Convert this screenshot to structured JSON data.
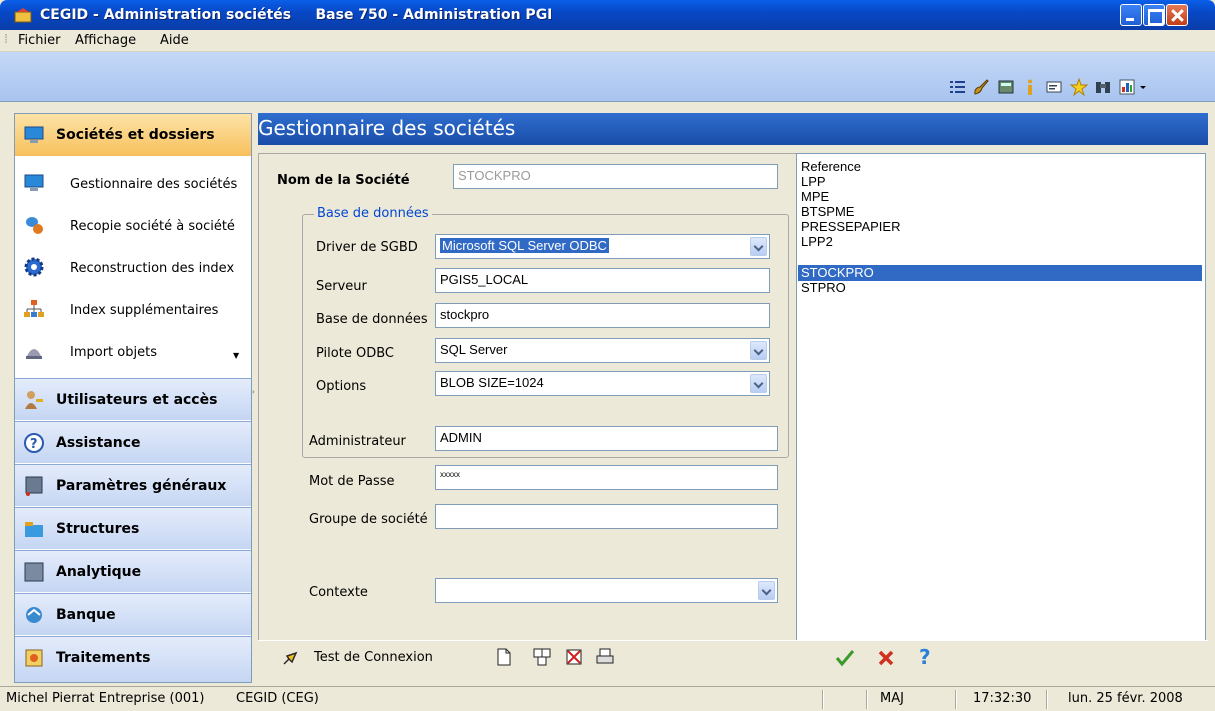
{
  "window": {
    "app_title": "CEGID - Administration sociétés     Base 750 - Administration PGI"
  },
  "menu": {
    "fichier": "Fichier",
    "affichage": "Affichage",
    "aide": "Aide"
  },
  "toolbar_icons": [
    "list-icon",
    "brush-icon",
    "calculator-icon",
    "info-icon",
    "window-icon",
    "star-icon",
    "binoculars-icon",
    "chart-icon"
  ],
  "sidebar": {
    "active_section": "Sociétés et dossiers",
    "items": [
      {
        "label": "Gestionnaire des sociétés",
        "icon": "monitor-icon"
      },
      {
        "label": "Recopie société à société",
        "icon": "copy-database-icon"
      },
      {
        "label": "Reconstruction des index",
        "icon": "gear-icon"
      },
      {
        "label": "Index supplémentaires",
        "icon": "hierarchy-icon"
      },
      {
        "label": "Import objets",
        "icon": "import-icon"
      }
    ],
    "sections": [
      {
        "label": "Utilisateurs et accès",
        "icon": "users-key-icon"
      },
      {
        "label": "Assistance",
        "icon": "help-circle-icon"
      },
      {
        "label": "Paramètres généraux",
        "icon": "settings-icon"
      },
      {
        "label": "Structures",
        "icon": "folder-icon"
      },
      {
        "label": "Analytique",
        "icon": "analytics-icon"
      },
      {
        "label": "Banque",
        "icon": "bank-icon"
      },
      {
        "label": "Traitements",
        "icon": "process-icon"
      }
    ]
  },
  "main": {
    "header": "Gestionnaire des sociétés",
    "form": {
      "nom_label": "Nom de la Société",
      "nom_value": "STOCKPRO",
      "group_title": "Base de données",
      "driver_label": "Driver de SGBD",
      "driver_value": "Microsoft SQL Server ODBC",
      "serveur_label": "Serveur",
      "serveur_value": "PGIS5_LOCAL",
      "base_label": "Base de données",
      "base_value": "stockpro",
      "pilote_label": "Pilote ODBC",
      "pilote_value": "SQL Server",
      "options_label": "Options",
      "options_value": "BLOB SIZE=1024",
      "admin_label": "Administrateur",
      "admin_value": "ADMIN",
      "pass_label": "Mot de Passe",
      "pass_value": "xxxxx",
      "groupe_label": "Groupe de société",
      "groupe_value": "",
      "contexte_label": "Contexte",
      "contexte_value": ""
    },
    "list": [
      "Reference",
      "LPP",
      "MPE",
      "BTSPME",
      "PRESSEPAPIER",
      "LPP2",
      "STOCKPRO",
      "STPRO"
    ],
    "selected_list_item": "STOCKPRO",
    "bottom": {
      "test_label": "Test de Connexion"
    }
  },
  "status": {
    "user": "Michel Pierrat Entreprise (001)",
    "base": "CEGID (CEG)",
    "caps": "MAJ",
    "time": "17:32:30",
    "date": "lun. 25 févr. 2008"
  },
  "colors": {
    "title_blue": "#0A5FE8",
    "header_blue": "#2f6ecf",
    "selection": "#316AC5",
    "active_section": "#f7c05c",
    "check_green": "#3a9a2a",
    "cancel_red": "#d03020",
    "help_blue": "#2a7fd6"
  }
}
